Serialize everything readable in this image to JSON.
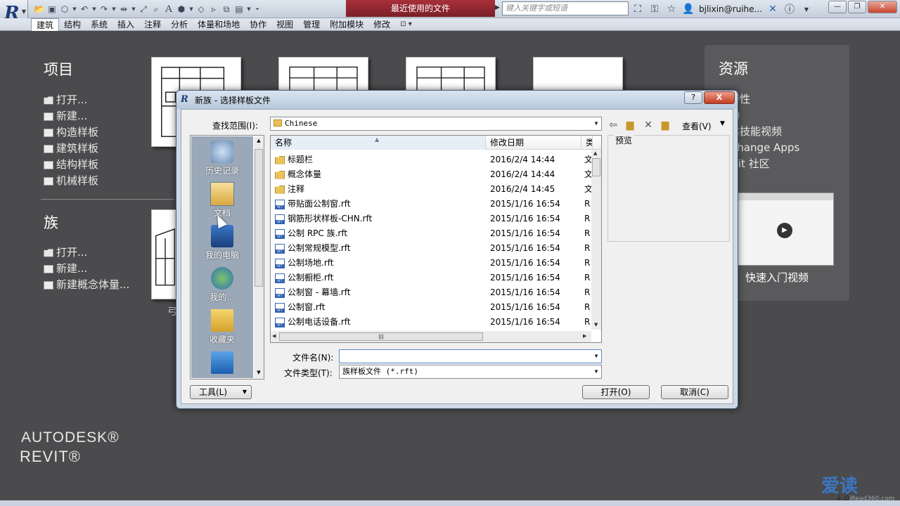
{
  "titlebar": {
    "document_title": "最近使用的文件",
    "search_placeholder": "键入关键字或短语",
    "user": "bjlixin@ruihe...",
    "icons": [
      "binoculars-icon",
      "key-icon",
      "star-icon",
      "user-icon",
      "exchange-icon",
      "help-icon"
    ]
  },
  "ribbon": {
    "tabs": [
      "建筑",
      "结构",
      "系统",
      "插入",
      "注释",
      "分析",
      "体量和场地",
      "协作",
      "视图",
      "管理",
      "附加模块",
      "修改"
    ],
    "active_tab": "建筑"
  },
  "page": {
    "projects": {
      "title": "项目",
      "items": [
        "打开...",
        "新建...",
        "构造样板",
        "建筑样板",
        "结构样板",
        "机械样板"
      ]
    },
    "families": {
      "title": "族",
      "items": [
        "打开...",
        "新建...",
        "新建概念体量..."
      ]
    },
    "thumb_label_partial": "弓",
    "resources": {
      "title": "资源",
      "items": [
        "新特性",
        "帮助",
        "基本技能视频",
        "Exchange Apps",
        "Revit 社区"
      ],
      "video_label": "快速入门视频"
    },
    "brand_autodesk": "AUTODESK®",
    "brand_revit": "REVIT®",
    "watermark": "爱读",
    "watermark_sub": "iRead360.com"
  },
  "dialog": {
    "title": "新族 - 选择样板文件",
    "look_in_label": "查找范围(I):",
    "look_in_value": "Chinese",
    "views_label": "查看(V)",
    "places": [
      {
        "label": "历史记录",
        "icon": "history-icon"
      },
      {
        "label": "文档",
        "icon": "documents-folder-icon"
      },
      {
        "label": "我的电脑",
        "icon": "computer-icon"
      },
      {
        "label": "我的...",
        "icon": "network-icon"
      },
      {
        "label": "收藏夹",
        "icon": "favorites-icon"
      },
      {
        "label": "",
        "icon": "desktop-icon"
      }
    ],
    "columns": {
      "name": "名称",
      "date": "修改日期",
      "type": "类"
    },
    "files": [
      {
        "name": "标题栏",
        "date": "2016/2/4 14:44",
        "type": "文",
        "kind": "folder"
      },
      {
        "name": "概念体量",
        "date": "2016/2/4 14:44",
        "type": "文",
        "kind": "folder"
      },
      {
        "name": "注释",
        "date": "2016/2/4 14:45",
        "type": "文",
        "kind": "folder"
      },
      {
        "name": "带贴面公制窗.rft",
        "date": "2015/1/16 16:54",
        "type": "R",
        "kind": "rft"
      },
      {
        "name": "钢筋形状样板-CHN.rft",
        "date": "2015/1/16 16:54",
        "type": "R",
        "kind": "rft"
      },
      {
        "name": "公制 RPC 族.rft",
        "date": "2015/1/16 16:54",
        "type": "R",
        "kind": "rft"
      },
      {
        "name": "公制常规模型.rft",
        "date": "2015/1/16 16:54",
        "type": "R",
        "kind": "rft"
      },
      {
        "name": "公制场地.rft",
        "date": "2015/1/16 16:54",
        "type": "R",
        "kind": "rft"
      },
      {
        "name": "公制橱柜.rft",
        "date": "2015/1/16 16:54",
        "type": "R",
        "kind": "rft"
      },
      {
        "name": "公制窗 - 幕墙.rft",
        "date": "2015/1/16 16:54",
        "type": "R",
        "kind": "rft"
      },
      {
        "name": "公制窗.rft",
        "date": "2015/1/16 16:54",
        "type": "R",
        "kind": "rft"
      },
      {
        "name": "公制电话设备.rft",
        "date": "2015/1/16 16:54",
        "type": "R",
        "kind": "rft"
      }
    ],
    "preview_label": "预览",
    "filename_label": "文件名(N):",
    "filename_value": "",
    "filetype_label": "文件类型(T):",
    "filetype_value": "族样板文件 (*.rft)",
    "tools_label": "工具(L)",
    "open_label": "打开(O)",
    "cancel_label": "取消(C)",
    "help_label": "?",
    "close_label": "X"
  },
  "colors": {
    "page_bg": "#4b4b4d",
    "doc_title_bg": "#8a2430",
    "dialog_frame": "#cfd9e6"
  }
}
